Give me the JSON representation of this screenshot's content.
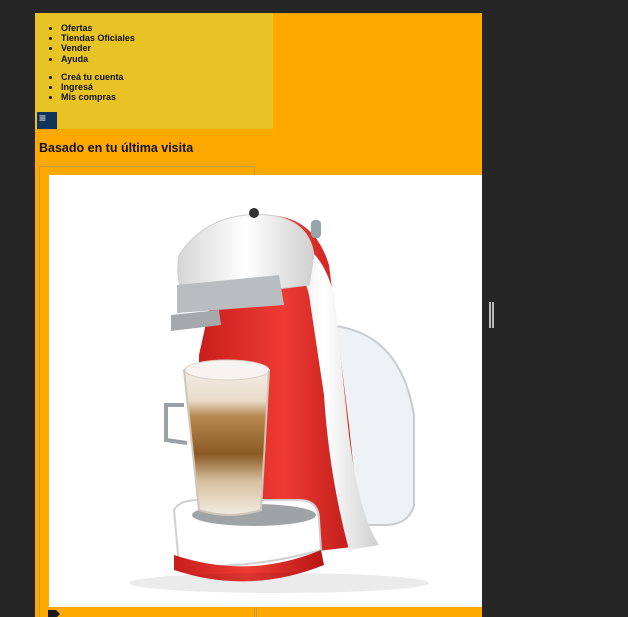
{
  "nav": {
    "items": [
      "Ofertas",
      "Tiendas Oficiales",
      "Vender",
      "Ayuda"
    ],
    "account_items": [
      "Creá tu cuenta",
      "Ingresá",
      "Mis compras"
    ],
    "menu_icon": "hamburger-menu-icon"
  },
  "section": {
    "title": "Basado en tu última visita"
  },
  "product": {
    "image": "coffee-machine-image"
  },
  "colors": {
    "page_bg": "#ffa800",
    "menu_bg": "#e8c325",
    "outer_bg": "#262626",
    "menu_button_bg": "#12345a",
    "machine_red": "#e3302b"
  }
}
